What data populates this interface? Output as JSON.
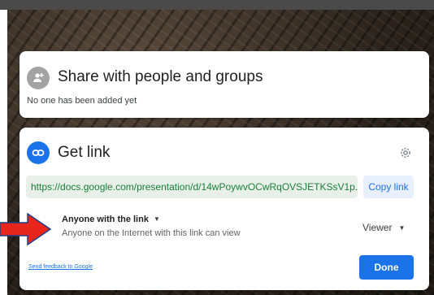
{
  "share_card": {
    "title": "Share with people and groups",
    "subtitle": "No one has been added yet",
    "icon": "add-person-icon"
  },
  "link_card": {
    "title": "Get link",
    "icon": "link-icon",
    "settings_icon": "gear-icon",
    "url": "https://docs.google.com/presentation/d/14wPoywvOCwRqOVSJETKSsV1p...",
    "copy_label": "Copy link",
    "access": {
      "label": "Anyone with the link",
      "description": "Anyone on the Internet with this link can view"
    },
    "role": "Viewer",
    "feedback_label": "Send feedback to Google",
    "done_label": "Done"
  },
  "annotation": {
    "arrow_icon": "red-arrow-icon",
    "arrow_color": "#e8261c"
  },
  "colors": {
    "accent": "#1a73e8",
    "link_green": "#188038"
  }
}
